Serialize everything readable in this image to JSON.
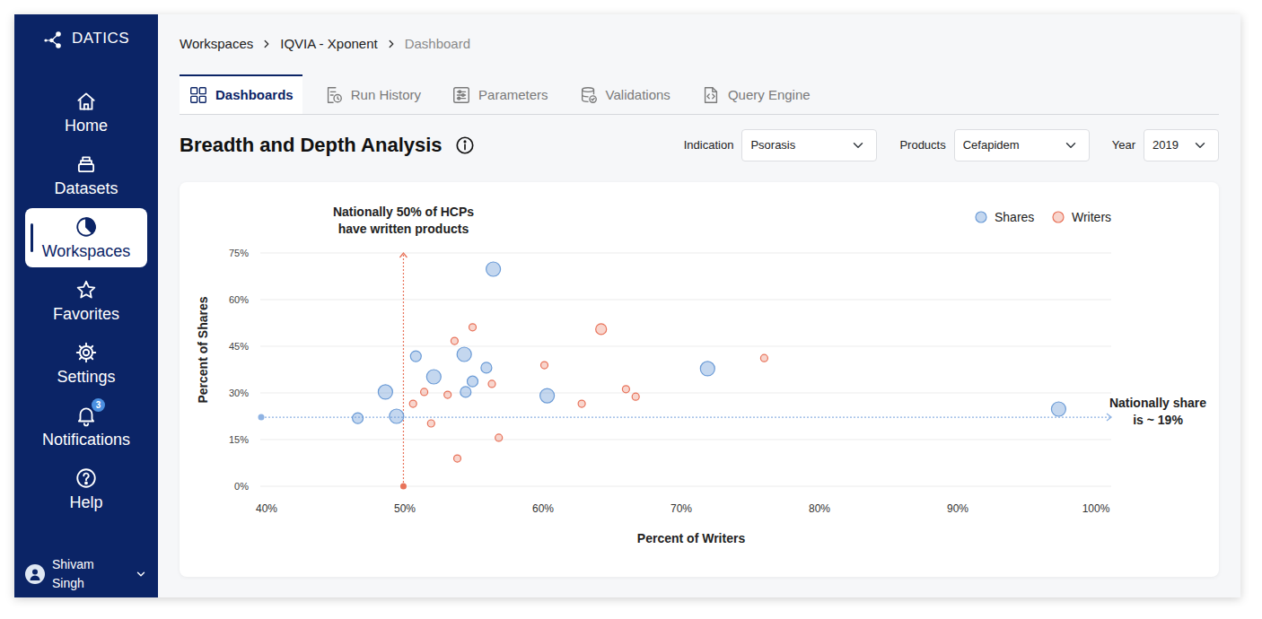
{
  "brand": {
    "name": "DATICS"
  },
  "sidebar": {
    "items": [
      {
        "label": "Home",
        "selected": false
      },
      {
        "label": "Datasets",
        "selected": false
      },
      {
        "label": "Workspaces",
        "selected": true
      },
      {
        "label": "Favorites",
        "selected": false
      },
      {
        "label": "Settings",
        "selected": false
      },
      {
        "label": "Notifications",
        "selected": false,
        "badge": "3"
      },
      {
        "label": "Help",
        "selected": false
      }
    ],
    "user": {
      "name": "Shivam Singh"
    }
  },
  "breadcrumb": [
    {
      "label": "Workspaces",
      "selected": false
    },
    {
      "label": "IQVIA - Xponent",
      "selected": false
    },
    {
      "label": "Dashboard",
      "selected": true
    }
  ],
  "tabs": [
    {
      "label": "Dashboards",
      "selected": true
    },
    {
      "label": "Run History",
      "selected": false
    },
    {
      "label": "Parameters",
      "selected": false
    },
    {
      "label": "Validations",
      "selected": false
    },
    {
      "label": "Query Engine",
      "selected": false
    }
  ],
  "page": {
    "title": "Breadth and Depth Analysis"
  },
  "filters": [
    {
      "label": "Indication",
      "value": "Psorasis"
    },
    {
      "label": "Products",
      "value": "Cefapidem"
    },
    {
      "label": "Year",
      "value": "2019"
    }
  ],
  "chart": {
    "y_axis": {
      "title": "Percent of Shares",
      "ticks": [
        "75%",
        "60%",
        "45%",
        "30%",
        "15%",
        "0%"
      ]
    },
    "x_axis": {
      "title": "Percent of Writers",
      "ticks": [
        "40%",
        "50%",
        "60%",
        "70%",
        "80%",
        "90%",
        "100%"
      ]
    },
    "series": [
      {
        "name": "Shares",
        "color": "#6b9bd6",
        "points": [
          {
            "x": 56.4,
            "y": 69.8,
            "z": 2
          },
          {
            "x": 50.8,
            "y": 41.8,
            "z": 1.5
          },
          {
            "x": 54.3,
            "y": 42.4,
            "z": 2
          },
          {
            "x": 55.9,
            "y": 38.1,
            "z": 1.5
          },
          {
            "x": 52.1,
            "y": 35.2,
            "z": 2
          },
          {
            "x": 54.9,
            "y": 33.7,
            "z": 1.5
          },
          {
            "x": 48.6,
            "y": 30.3,
            "z": 2
          },
          {
            "x": 54.4,
            "y": 30.3,
            "z": 1.5
          },
          {
            "x": 60.3,
            "y": 29.1,
            "z": 2
          },
          {
            "x": 71.9,
            "y": 37.8,
            "z": 2
          },
          {
            "x": 46.6,
            "y": 21.9,
            "z": 1.5
          },
          {
            "x": 49.4,
            "y": 22.5,
            "z": 2
          },
          {
            "x": 97.3,
            "y": 24.8,
            "z": 2
          }
        ]
      },
      {
        "name": "Writers",
        "color": "#e8735a",
        "points": [
          {
            "x": 54.9,
            "y": 51.1,
            "z": 1
          },
          {
            "x": 64.2,
            "y": 50.5,
            "z": 1.5
          },
          {
            "x": 53.6,
            "y": 46.7,
            "z": 1
          },
          {
            "x": 76.0,
            "y": 41.2,
            "z": 1
          },
          {
            "x": 60.1,
            "y": 38.9,
            "z": 1
          },
          {
            "x": 56.3,
            "y": 32.9,
            "z": 1
          },
          {
            "x": 51.4,
            "y": 30.3,
            "z": 1
          },
          {
            "x": 53.1,
            "y": 29.4,
            "z": 1
          },
          {
            "x": 66.0,
            "y": 31.2,
            "z": 1
          },
          {
            "x": 66.7,
            "y": 28.8,
            "z": 1
          },
          {
            "x": 50.6,
            "y": 26.5,
            "z": 1
          },
          {
            "x": 62.8,
            "y": 26.5,
            "z": 1
          },
          {
            "x": 51.9,
            "y": 20.2,
            "z": 1
          },
          {
            "x": 56.8,
            "y": 15.6,
            "z": 1
          },
          {
            "x": 53.8,
            "y": 8.9,
            "z": 1
          }
        ]
      }
    ],
    "reference_lines": [
      {
        "axis": "x",
        "value": 49.9,
        "color": "#e8735a",
        "label": [
          "Nationally 50% of HCPs",
          "have written products"
        ]
      },
      {
        "axis": "y",
        "value": 22.2,
        "color": "#8fb3e3",
        "label": [
          "Nationally share",
          "is ~ 19%"
        ]
      }
    ]
  }
}
